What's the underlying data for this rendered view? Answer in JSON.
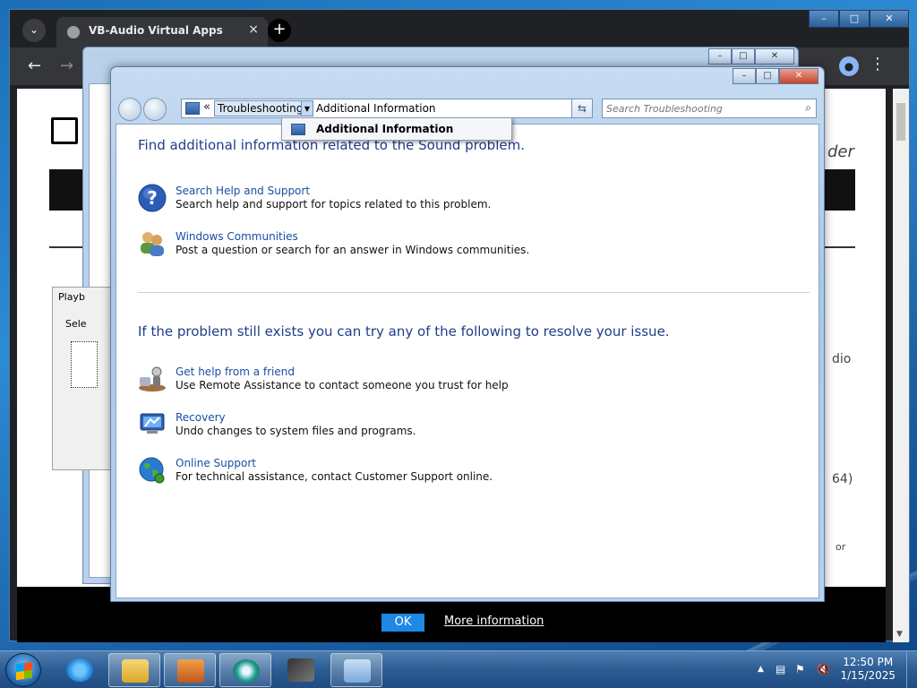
{
  "chrome": {
    "tab_title": "VB-Audio Virtual Apps",
    "tab_close": "×",
    "menu_glyph": "⌄",
    "new_tab": "+",
    "back": "←",
    "forward": "→",
    "minimize": "–",
    "maximize": "□",
    "close": "✕",
    "profile_glyph": "●",
    "kebab": "⋮",
    "page_side_texts": [
      "dio",
      "64)",
      "or"
    ],
    "page_fragment_der": "der",
    "cookie_ok": "OK",
    "cookie_more": "More information"
  },
  "back_window": {
    "panel_tab": "Playb",
    "panel_text": "Sele"
  },
  "troubleshoot": {
    "breadcrumb_chevron": "«",
    "breadcrumb_root": "Troubleshooting",
    "breadcrumb_current": "Additional Information",
    "dropdown_item": "Additional Information",
    "search_placeholder": "Search Troubleshooting",
    "minimize": "–",
    "maximize": "□",
    "close": "✕",
    "heading_1": "Find additional information related to the Sound problem.",
    "heading_2": "If the problem still exists you can try any of the following to resolve your issue.",
    "items_1": [
      {
        "icon": "help-icon",
        "title": "Search Help and Support",
        "desc": "Search help and support for topics related to this problem."
      },
      {
        "icon": "communities-icon",
        "title": "Windows Communities",
        "desc": "Post a question or search for an answer in Windows communities."
      }
    ],
    "items_2": [
      {
        "icon": "remote-assistance-icon",
        "title": "Get help from a friend",
        "desc": "Use Remote Assistance to contact someone you trust for help"
      },
      {
        "icon": "recovery-icon",
        "title": "Recovery",
        "desc": "Undo changes to system files and programs."
      },
      {
        "icon": "globe-icon",
        "title": "Online Support",
        "desc": "For technical assistance, contact Customer Support online."
      }
    ]
  },
  "taskbar": {
    "time": "12:50 PM",
    "date": "1/15/2025",
    "tray_up": "▲"
  },
  "colors": {
    "link": "#1a4ea3",
    "heading": "#1e3e8a",
    "ok_button": "#1e88e5"
  }
}
